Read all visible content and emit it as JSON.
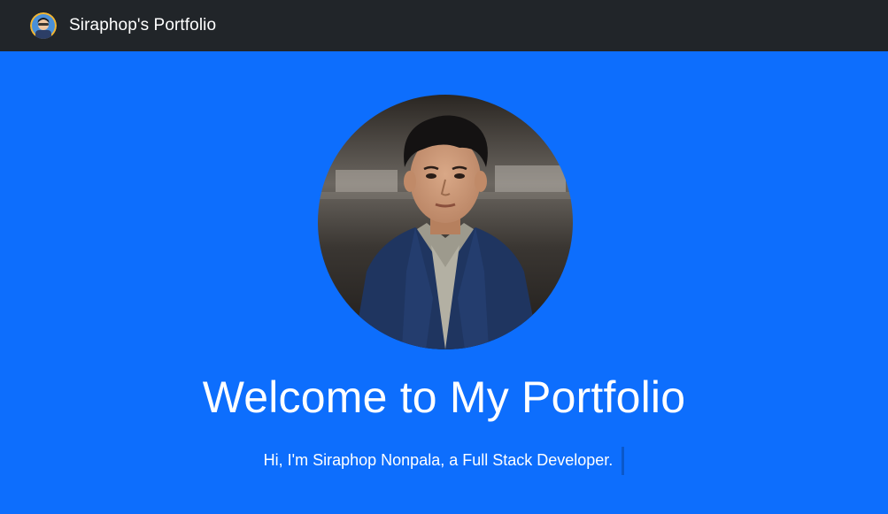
{
  "navbar": {
    "brand_text": "Siraphop's Portfolio",
    "brand_logo_icon": "avatar-logo-icon",
    "background_color": "#212529"
  },
  "hero": {
    "background_color": "#0d6efd",
    "profile_image_icon": "profile-photo",
    "title": "Welcome to My Portfolio",
    "subtitle": "Hi, I'm Siraphop Nonpala, a Full Stack Developer.",
    "text_color": "#ffffff"
  }
}
